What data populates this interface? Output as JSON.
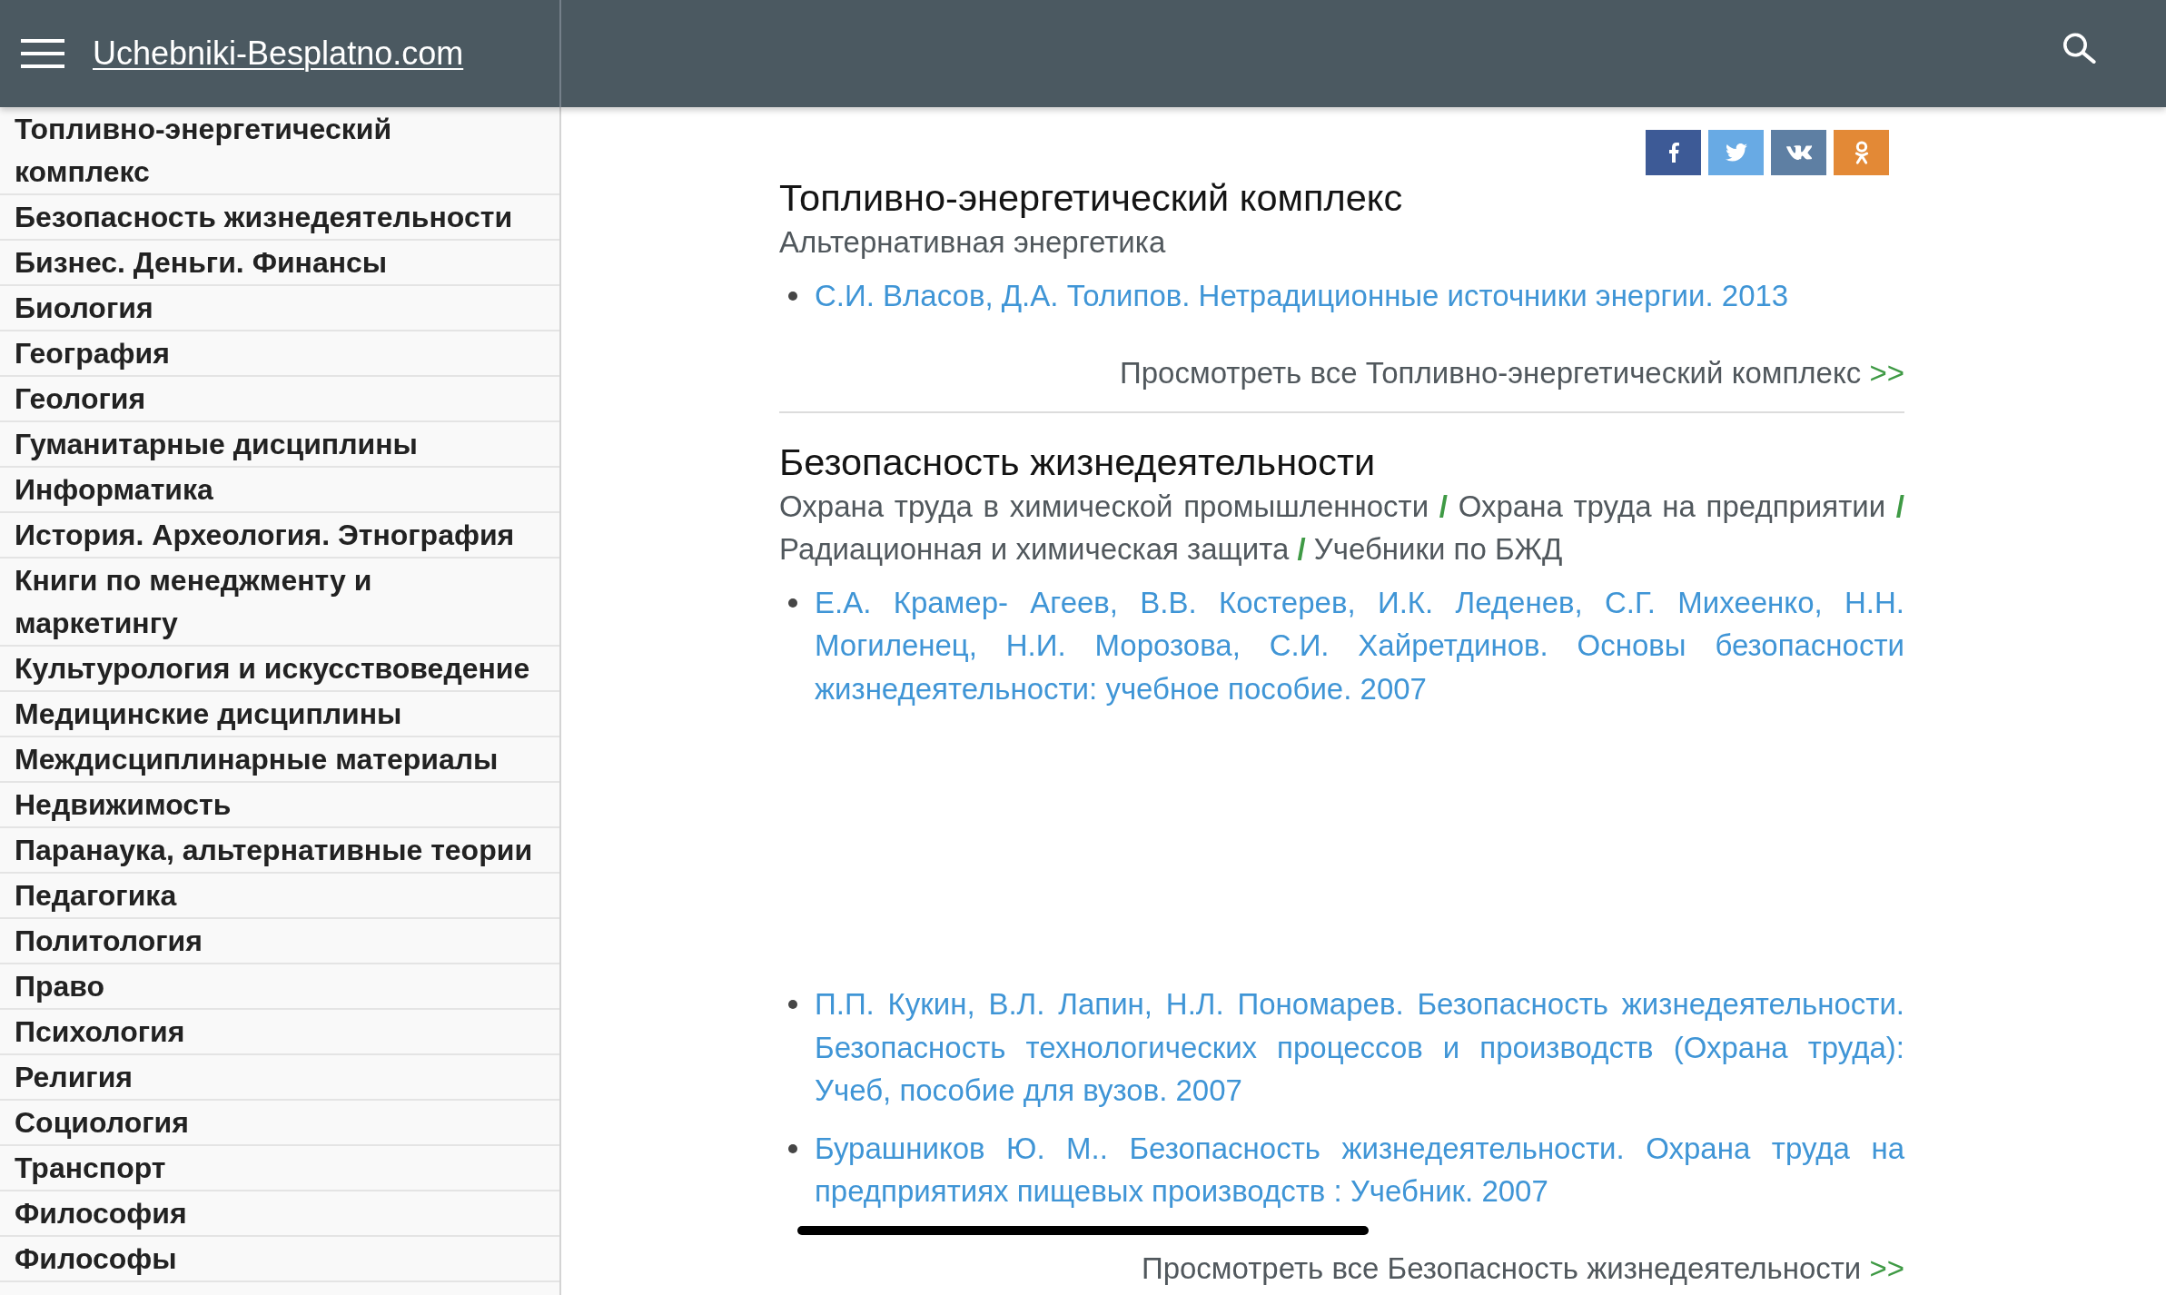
{
  "header": {
    "site_title": "Uchebniki-Besplatno.com"
  },
  "sidebar": {
    "items": [
      {
        "label": "Топливно-энергетический комплекс"
      },
      {
        "label": "Безопасность жизнедеятельности"
      },
      {
        "label": "Бизнес. Деньги. Финансы"
      },
      {
        "label": "Биология"
      },
      {
        "label": "География"
      },
      {
        "label": "Геология"
      },
      {
        "label": "Гуманитарные дисциплины"
      },
      {
        "label": "Информатика"
      },
      {
        "label": "История. Археология. Этнография"
      },
      {
        "label": "Книги по менеджменту и маркетингу"
      },
      {
        "label": "Культурология и искусствоведение"
      },
      {
        "label": "Медицинские дисциплины"
      },
      {
        "label": "Междисциплинарные материалы"
      },
      {
        "label": "Недвижимость"
      },
      {
        "label": "Паранаука, альтернативные теории"
      },
      {
        "label": "Педагогика"
      },
      {
        "label": "Политология"
      },
      {
        "label": "Право"
      },
      {
        "label": "Психология"
      },
      {
        "label": "Религия"
      },
      {
        "label": "Социология"
      },
      {
        "label": "Транспорт"
      },
      {
        "label": "Философия"
      },
      {
        "label": "Философы"
      }
    ]
  },
  "share_buttons": [
    {
      "kind": "facebook",
      "color": "#3d5a96"
    },
    {
      "kind": "twitter",
      "color": "#68aae4"
    },
    {
      "kind": "vk",
      "color": "#5e7fa3"
    },
    {
      "kind": "odnoklassniki",
      "color": "#e38936"
    }
  ],
  "sections": [
    {
      "title": "Топливно-энергетический комплекс",
      "subcategories": [
        {
          "label": "Альтернативная энергетика"
        }
      ],
      "books": [
        {
          "title": "С.И. Власов, Д.А. Толипов. Нетрадиционные источники энергии. 2013",
          "gap_before": false
        }
      ],
      "view_all": {
        "text": "Просмотреть все Топливно-энергетический комплекс",
        "arrow": ">>"
      }
    },
    {
      "title": "Безопасность жизнедеятельности",
      "subcategories": [
        {
          "label": "Охрана труда в химической промышленности",
          "separator": "/"
        },
        {
          "label": "Охрана труда на предприятии",
          "separator": "/"
        },
        {
          "label": "Радиационная и химическая защита",
          "separator": "/"
        },
        {
          "label": "Учебники по БЖД"
        }
      ],
      "books": [
        {
          "title": "Е.А. Крамер- Агеев, В.В. Костерев, И.К. Леденев, С.Г. Михеенко, Н.Н. Могиленец, Н.И. Морозова, С.И. Хайретдинов. Основы безопасности жизнедеятельности: учебное пособие. 2007",
          "gap_before": false
        },
        {
          "title": "П.П. Кукин, В.Л. Лапин, Н.Л. Пономарев. Безопасность жизнедеятельности. Безопасность технологических процессов и производств (Охрана труда): Учеб, пособие для вузов. 2007",
          "gap_before": true
        },
        {
          "title": "Бурашников Ю. М.. Безопасность жизнедеятельности. Охрана труда на предприятиях пищевых производств : Учебник. 2007",
          "gap_before": false
        }
      ],
      "view_all": {
        "text": "Просмотреть все Безопасность жизнедеятельности",
        "arrow": ">>"
      }
    }
  ]
}
